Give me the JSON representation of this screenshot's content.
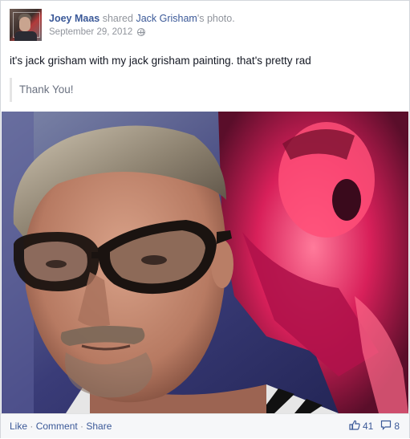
{
  "post": {
    "actor": "Joey Maas",
    "shared_text": "shared",
    "owner": "Jack Grisham",
    "owner_suffix": "'s photo.",
    "date": "September 29, 2012",
    "privacy_icon": "globe-icon",
    "message": "it's jack grisham with my jack grisham painting. that's pretty rad",
    "quote": "Thank You!"
  },
  "footer": {
    "like": "Like",
    "comment": "Comment",
    "share": "Share",
    "separator": " · ",
    "likes_count": "41",
    "comments_count": "8",
    "like_icon": "thumbs-up-icon",
    "comment_icon": "comment-bubble-icon"
  },
  "colors": {
    "link": "#3b5998",
    "meta": "#90949c",
    "footer_bg": "#f6f7f9"
  }
}
